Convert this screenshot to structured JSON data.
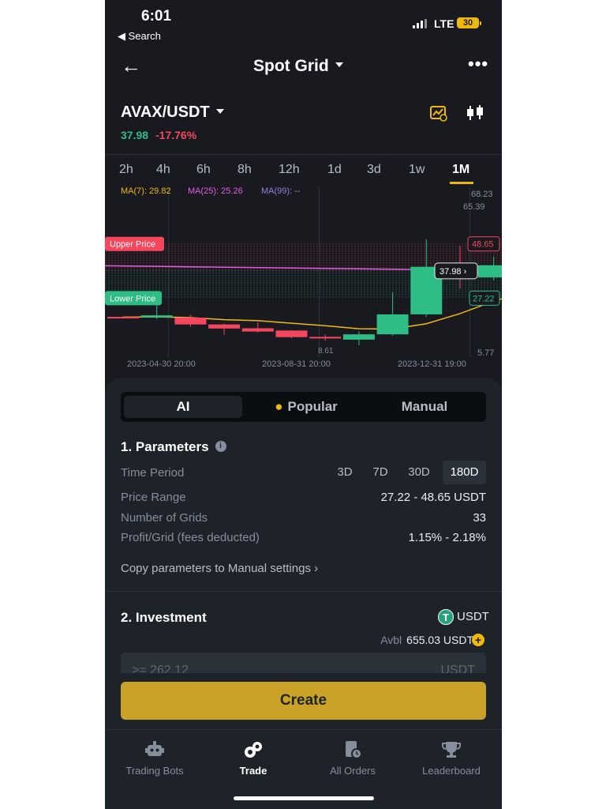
{
  "status_bar": {
    "time": "6:01",
    "back_app": "◀ Search",
    "network": "LTE",
    "battery": "30"
  },
  "nav": {
    "back_icon": "arrow-left-icon",
    "title": "Spot Grid",
    "more_icon": "more-icon"
  },
  "pair": {
    "symbol": "AVAX/USDT",
    "price": "37.98",
    "change": "-17.76%"
  },
  "timeframes": [
    "2h",
    "4h",
    "6h",
    "8h",
    "12h",
    "1d",
    "3d",
    "1w",
    "1M"
  ],
  "active_timeframe": "1M",
  "chart": {
    "ma7": "MA(7): 29.82",
    "ma25": "MA(25): 25.26",
    "ma99": "MA(99): --",
    "upper_price_label": "Upper Price",
    "lower_price_label": "Lower Price",
    "upper_price": "48.65",
    "lower_price": "27.22",
    "current_price": "37.98",
    "current_price_marker": "37.98 ›",
    "axis_high": "68.23",
    "axis_max": "65.39",
    "axis_low": "5.77",
    "low_marker": "8.61",
    "dates": [
      "2023-04-30 20:00",
      "2023-08-31 20:00",
      "2023-12-31 19:00"
    ],
    "colors": {
      "up": "#2ebd85",
      "down": "#f6465d",
      "ma7": "#f0b90b",
      "ma25": "#e45ae6",
      "ma99": "#9b7bdc"
    }
  },
  "chart_data": {
    "type": "candlestick",
    "title": "",
    "xlabel": "",
    "ylabel": "",
    "ylim": [
      5.77,
      68.23
    ],
    "x_tick_labels": [
      "2023-04-30 20:00",
      "2023-08-31 20:00",
      "2023-12-31 19:00"
    ],
    "candles": [
      {
        "open": 19.8,
        "close": 19.6,
        "high": 20.0,
        "low": 19.3
      },
      {
        "open": 19.6,
        "close": 20.4,
        "high": 24.6,
        "low": 18.9
      },
      {
        "open": 19.5,
        "close": 16.8,
        "high": 20.7,
        "low": 15.9
      },
      {
        "open": 16.8,
        "close": 15.2,
        "high": 17.2,
        "low": 12.7
      },
      {
        "open": 15.3,
        "close": 14.0,
        "high": 17.6,
        "low": 13.6
      },
      {
        "open": 14.4,
        "close": 11.8,
        "high": 14.6,
        "low": 11.3
      },
      {
        "open": 11.9,
        "close": 11.3,
        "high": 12.8,
        "low": 10.4
      },
      {
        "open": 10.8,
        "close": 12.9,
        "high": 14.1,
        "low": 8.61
      },
      {
        "open": 12.9,
        "close": 20.8,
        "high": 29.5,
        "low": 12.3
      },
      {
        "open": 20.8,
        "close": 39.6,
        "high": 50.5,
        "low": 19.8
      },
      {
        "open": 39.6,
        "close": 35.4,
        "high": 47.8,
        "low": 31.0
      },
      {
        "open": 35.4,
        "close": 40.2,
        "high": 43.6,
        "low": 34.2
      },
      {
        "open": 40.2,
        "close": 53.0,
        "high": 54.0,
        "low": 37.98
      }
    ],
    "ma7": [
      19.7,
      19.8,
      19.5,
      18.7,
      18.3,
      17.3,
      16.3,
      15.1,
      15.0,
      17.1,
      21.1,
      26.0,
      29.82
    ],
    "ma25_from_index": 9,
    "ma25": [
      38.5,
      37.6,
      36.9,
      36.2
    ],
    "upper_price": 48.65,
    "lower_price": 27.22,
    "current_price": 37.98
  },
  "strategy_tabs": [
    "AI",
    "Popular",
    "Manual"
  ],
  "active_strategy": "AI",
  "parameters": {
    "title": "1. Parameters",
    "time_period_label": "Time Period",
    "periods": [
      "3D",
      "7D",
      "30D",
      "180D"
    ],
    "active_period": "180D",
    "price_range_label": "Price Range",
    "price_range": "27.22 - 48.65 USDT",
    "grids_label": "Number of Grids",
    "grids": "33",
    "profit_label": "Profit/Grid (fees deducted)",
    "profit": "1.15% - 2.18%",
    "copy_link": "Copy parameters to Manual settings ›"
  },
  "investment": {
    "title": "2. Investment",
    "currency": "USDT",
    "currency_icon": "tether-icon",
    "avbl_label": "Avbl",
    "avbl_value": "655.03 USDT",
    "input_placeholder": ">= 262.12",
    "input_unit": "USDT"
  },
  "create_button": "Create",
  "bottom_nav": [
    {
      "label": "Trading Bots",
      "icon": "robot-icon",
      "active": false
    },
    {
      "label": "Trade",
      "icon": "trade-icon",
      "active": true
    },
    {
      "label": "All Orders",
      "icon": "orders-icon",
      "active": false
    },
    {
      "label": "Leaderboard",
      "icon": "trophy-icon",
      "active": false
    }
  ]
}
